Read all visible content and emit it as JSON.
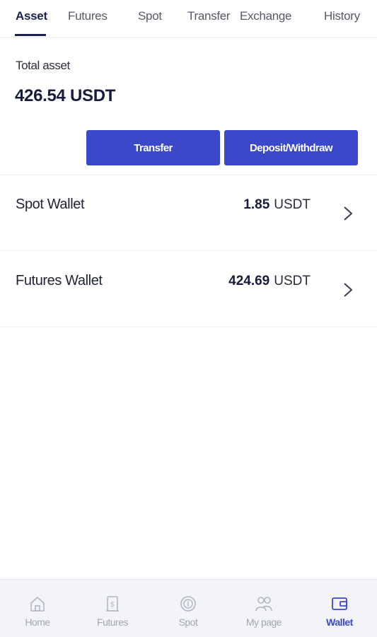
{
  "tabs": [
    {
      "label": "Asset",
      "active": true
    },
    {
      "label": "Futures",
      "active": false
    },
    {
      "label": "Spot",
      "active": false
    },
    {
      "label": "Transfer",
      "active": false
    },
    {
      "label": "Exchange",
      "active": false
    },
    {
      "label": "History",
      "active": false
    }
  ],
  "total": {
    "label": "Total asset",
    "value": "426.54 USDT"
  },
  "buttons": {
    "transfer": "Transfer",
    "deposit": "Deposit/Withdraw"
  },
  "wallets": [
    {
      "name": "Spot Wallet",
      "amount": "1.85",
      "unit": "USDT",
      "icon": "chevron-right-icon"
    },
    {
      "name": "Futures Wallet",
      "amount": "424.69",
      "unit": "USDT",
      "icon": "chevron-right-icon"
    }
  ],
  "bottom_nav": [
    {
      "label": "Home",
      "icon": "home-icon",
      "active": false
    },
    {
      "label": "Futures",
      "icon": "futures-icon",
      "active": false
    },
    {
      "label": "Spot",
      "icon": "spot-coin-icon",
      "active": false
    },
    {
      "label": "My page",
      "icon": "users-icon",
      "active": false
    },
    {
      "label": "Wallet",
      "icon": "wallet-icon",
      "active": true
    }
  ],
  "colors": {
    "accent": "#3a48c9",
    "active_tab": "#1b2150",
    "inactive_nav": "#a3a7b3"
  }
}
